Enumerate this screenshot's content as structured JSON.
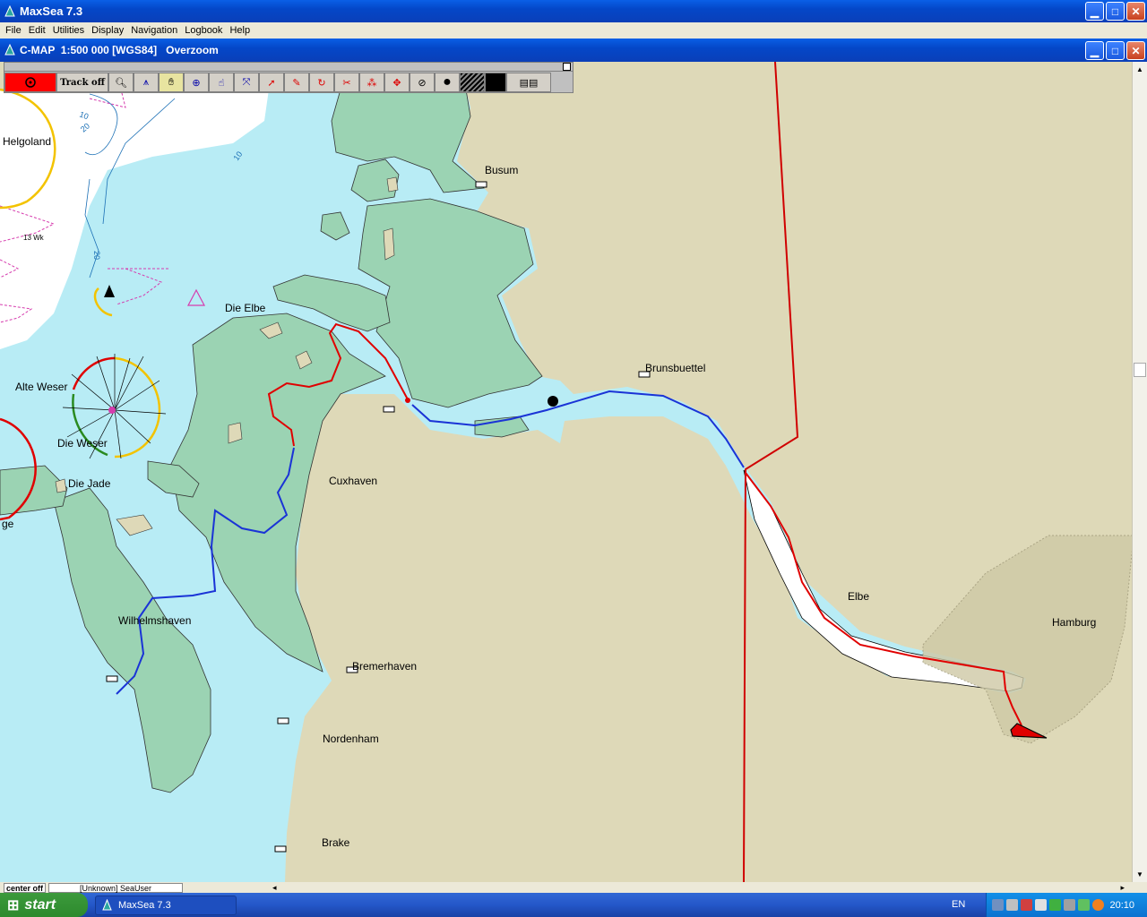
{
  "app": {
    "title": "MaxSea 7.3"
  },
  "menu": [
    "File",
    "Edit",
    "Utilities",
    "Display",
    "Navigation",
    "Logbook",
    "Help"
  ],
  "chart_window": {
    "title": "C-MAP  1:500 000 [WGS84]   Overzoom"
  },
  "toolbar": {
    "track_label": "Track off"
  },
  "map": {
    "places": {
      "helgoland": "Helgoland",
      "busum": "Busum",
      "die_elbe": "Die Elbe",
      "brunsbuettel": "Brunsbuettel",
      "alte_weser": "Alte Weser",
      "die_weser": "Die Weser",
      "die_jade": "Die Jade",
      "cuxhaven": "Cuxhaven",
      "elbe": "Elbe",
      "hamburg": "Hamburg",
      "wilhelmshaven": "Wilhelmshaven",
      "bremerhaven": "Bremerhaven",
      "nordenham": "Nordenham",
      "brake": "Brake",
      "partial_ge": "ge",
      "wk": "13 Wk"
    },
    "depths": {
      "d10a": "10",
      "d20a": "20",
      "d10b": "10",
      "d20b": "20"
    }
  },
  "status": {
    "center": "center off",
    "user": "[Unknown] SeaUser"
  },
  "taskbar": {
    "start": "start",
    "task": "MaxSea 7.3",
    "lang": "EN",
    "clock": "20:10"
  }
}
